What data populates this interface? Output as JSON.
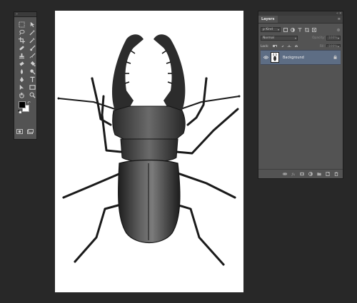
{
  "tools_panel": {
    "tools": [
      {
        "name": "marquee-tool-icon"
      },
      {
        "name": "move-tool-icon"
      },
      {
        "name": "lasso-tool-icon"
      },
      {
        "name": "magic-wand-tool-icon"
      },
      {
        "name": "crop-tool-icon"
      },
      {
        "name": "eyedropper-tool-icon"
      },
      {
        "name": "healing-brush-tool-icon"
      },
      {
        "name": "brush-tool-icon"
      },
      {
        "name": "clone-stamp-tool-icon"
      },
      {
        "name": "history-brush-tool-icon"
      },
      {
        "name": "eraser-tool-icon"
      },
      {
        "name": "paint-bucket-tool-icon"
      },
      {
        "name": "blur-tool-icon"
      },
      {
        "name": "dodge-tool-icon"
      },
      {
        "name": "pen-tool-icon"
      },
      {
        "name": "type-tool-icon"
      },
      {
        "name": "path-selection-tool-icon"
      },
      {
        "name": "rectangle-tool-icon"
      },
      {
        "name": "hand-tool-icon"
      },
      {
        "name": "zoom-tool-icon"
      }
    ],
    "foreground_color": "#000000",
    "background_color": "#ffffff"
  },
  "layers_panel": {
    "tab_label": "Layers",
    "filter_kind": "Kind",
    "blend_mode": "Normal",
    "opacity_label": "Opacity:",
    "opacity_value": "100%",
    "lock_label": "Lock:",
    "fill_label": "Fill:",
    "fill_value": "100%",
    "layers": [
      {
        "name": "Background",
        "visible": true,
        "locked": true,
        "selected": true
      }
    ]
  },
  "colors": {
    "app_background": "#282828",
    "panel": "#535353",
    "selected_layer": "#5d6d84"
  }
}
